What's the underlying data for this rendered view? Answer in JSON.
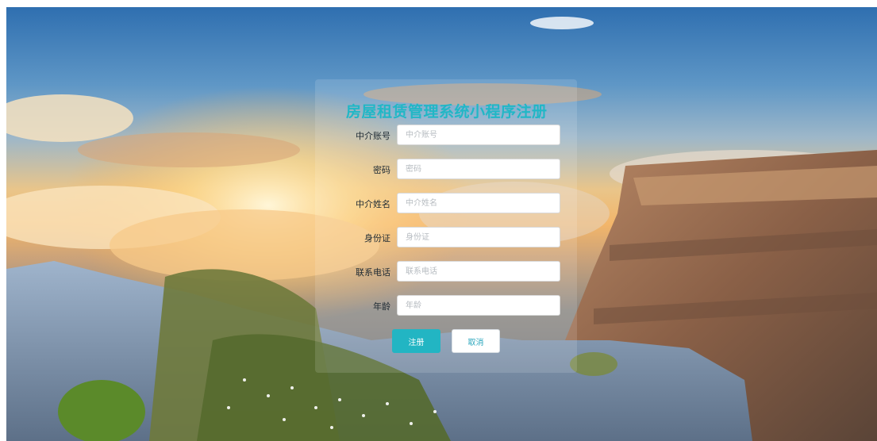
{
  "form": {
    "title": "房屋租赁管理系统小程序注册",
    "fields": [
      {
        "label": "中介账号",
        "placeholder": "中介账号",
        "value": ""
      },
      {
        "label": "密码",
        "placeholder": "密码",
        "value": ""
      },
      {
        "label": "中介姓名",
        "placeholder": "中介姓名",
        "value": ""
      },
      {
        "label": "身份证",
        "placeholder": "身份证",
        "value": ""
      },
      {
        "label": "联系电话",
        "placeholder": "联系电话",
        "value": ""
      },
      {
        "label": "年龄",
        "placeholder": "年龄",
        "value": ""
      }
    ],
    "register_label": "注册",
    "cancel_label": "取消"
  },
  "colors": {
    "accent": "#22b5c3",
    "title": "#21b7c6"
  }
}
